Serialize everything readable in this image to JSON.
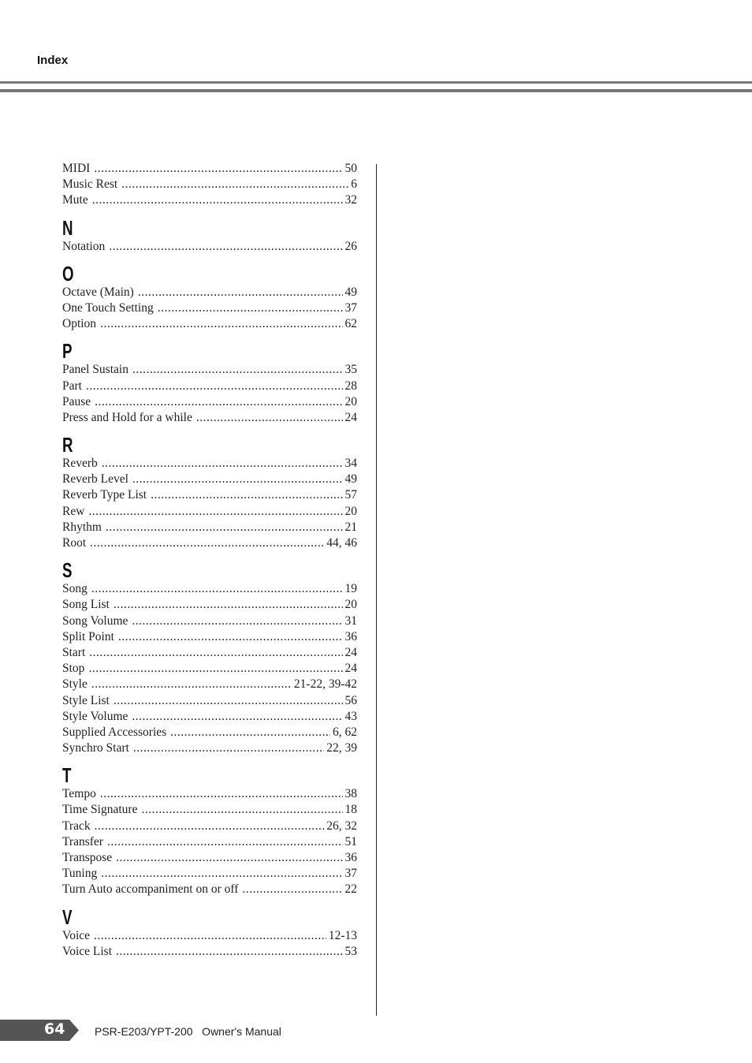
{
  "header": {
    "title": "Index"
  },
  "sections": [
    {
      "letter": "",
      "entries": [
        {
          "term": "MIDI",
          "page": "50"
        },
        {
          "term": "Music Rest",
          "page": "6"
        },
        {
          "term": "Mute",
          "page": "32"
        }
      ]
    },
    {
      "letter": "N",
      "entries": [
        {
          "term": "Notation",
          "page": "26"
        }
      ]
    },
    {
      "letter": "O",
      "entries": [
        {
          "term": "Octave (Main)",
          "page": "49"
        },
        {
          "term": "One Touch Setting",
          "page": "37"
        },
        {
          "term": "Option",
          "page": "62"
        }
      ]
    },
    {
      "letter": "P",
      "entries": [
        {
          "term": "Panel Sustain",
          "page": "35"
        },
        {
          "term": "Part",
          "page": "28"
        },
        {
          "term": "Pause",
          "page": "20"
        },
        {
          "term": "Press and Hold for a while",
          "page": "24"
        }
      ]
    },
    {
      "letter": "R",
      "entries": [
        {
          "term": "Reverb",
          "page": "34"
        },
        {
          "term": "Reverb Level",
          "page": "49"
        },
        {
          "term": "Reverb Type List",
          "page": "57"
        },
        {
          "term": "Rew",
          "page": "20"
        },
        {
          "term": "Rhythm",
          "page": "21"
        },
        {
          "term": "Root",
          "page": "44, 46"
        }
      ]
    },
    {
      "letter": "S",
      "entries": [
        {
          "term": "Song",
          "page": "19"
        },
        {
          "term": "Song List",
          "page": "20"
        },
        {
          "term": "Song Volume",
          "page": "31"
        },
        {
          "term": "Split Point",
          "page": "36"
        },
        {
          "term": "Start",
          "page": "24"
        },
        {
          "term": "Stop",
          "page": "24"
        },
        {
          "term": "Style",
          "page": "21-22, 39-42"
        },
        {
          "term": "Style List",
          "page": "56"
        },
        {
          "term": "Style Volume",
          "page": "43"
        },
        {
          "term": "Supplied Accessories",
          "page": "6, 62"
        },
        {
          "term": "Synchro Start",
          "page": "22, 39"
        }
      ]
    },
    {
      "letter": "T",
      "entries": [
        {
          "term": "Tempo",
          "page": "38"
        },
        {
          "term": "Time Signature",
          "page": "18"
        },
        {
          "term": "Track",
          "page": "26, 32"
        },
        {
          "term": "Transfer",
          "page": "51"
        },
        {
          "term": "Transpose",
          "page": "36"
        },
        {
          "term": "Tuning",
          "page": "37"
        },
        {
          "term": "Turn Auto accompaniment on or off",
          "page": "22"
        }
      ]
    },
    {
      "letter": "V",
      "entries": [
        {
          "term": "Voice",
          "page": "12-13"
        },
        {
          "term": "Voice List",
          "page": "53"
        }
      ]
    }
  ],
  "footer": {
    "page_number": "64",
    "manual_title": "PSR-E203/YPT-200   Owner's Manual"
  },
  "colors": {
    "rule": "#777777",
    "footer_tab": "#555555"
  }
}
